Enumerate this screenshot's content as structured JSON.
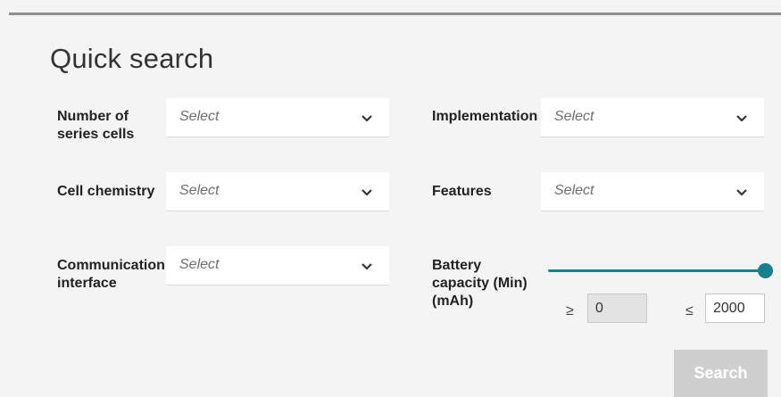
{
  "quick_search": {
    "title": "Quick search",
    "fields": {
      "series_cells": {
        "label": "Number of\nseries cells",
        "placeholder": "Select"
      },
      "implementation": {
        "label": "Implementation",
        "placeholder": "Select"
      },
      "cell_chemistry": {
        "label": "Cell chemistry",
        "placeholder": "Select"
      },
      "features": {
        "label": "Features",
        "placeholder": "Select"
      },
      "communication_interface": {
        "label": "Communication\ninterface",
        "placeholder": "Select"
      },
      "battery_capacity": {
        "label": "Battery\ncapacity (Min)\n(mAh)",
        "min_operator": "≥",
        "max_operator": "≤",
        "min_value": "0",
        "max_value": "2000",
        "slider_position": 1.0
      }
    },
    "search_label": "Search"
  },
  "colors": {
    "accent": "#17808c",
    "button_disabled": "#cfcfcf"
  }
}
